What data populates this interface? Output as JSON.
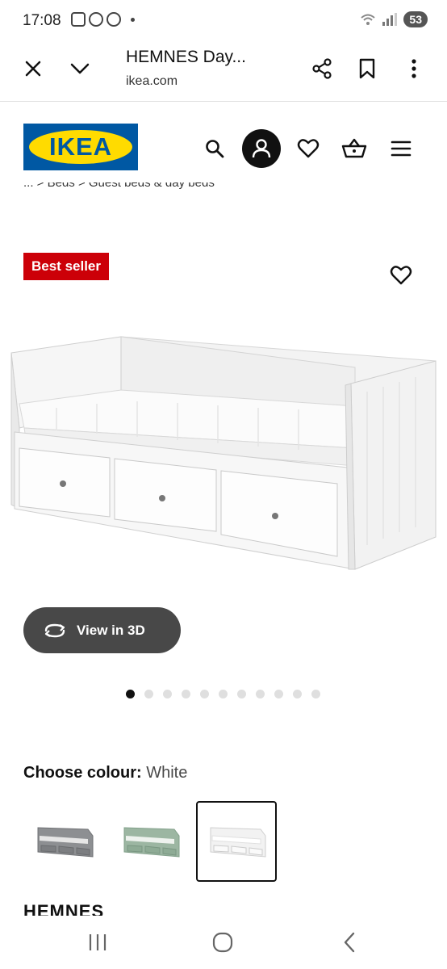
{
  "status_bar": {
    "time": "17:08",
    "battery": "53"
  },
  "browser": {
    "page_title": "HEMNES Day...",
    "domain": "ikea.com"
  },
  "header": {
    "logo_text": "IKEA"
  },
  "breadcrumb": {
    "text": "... > Beds > Guest beds & day beds"
  },
  "product": {
    "badge": "Best seller",
    "view_3d_label": "View in 3D",
    "image_count": 11,
    "active_image_index": 0,
    "colour_label": "Choose colour:",
    "colour_value": "White",
    "colour_options": [
      {
        "colour": "#8d8f92",
        "selected": false
      },
      {
        "colour": "#9cb6a2",
        "selected": false
      },
      {
        "colour": "#f2f2f2",
        "selected": true
      }
    ],
    "name": "HEMNES"
  },
  "colors": {
    "ikea_blue": "#0058a3",
    "ikea_yellow": "#ffdb00",
    "badge_red": "#cc0008",
    "button_dark": "#484848"
  },
  "icons": [
    "close-icon",
    "chevron-down-icon",
    "share-icon",
    "bookmark-icon",
    "more-vert-icon",
    "search-icon",
    "account-icon",
    "heart-icon",
    "basket-icon",
    "menu-icon",
    "rotate-3d-icon",
    "recent-apps-icon",
    "home-icon",
    "back-icon"
  ]
}
